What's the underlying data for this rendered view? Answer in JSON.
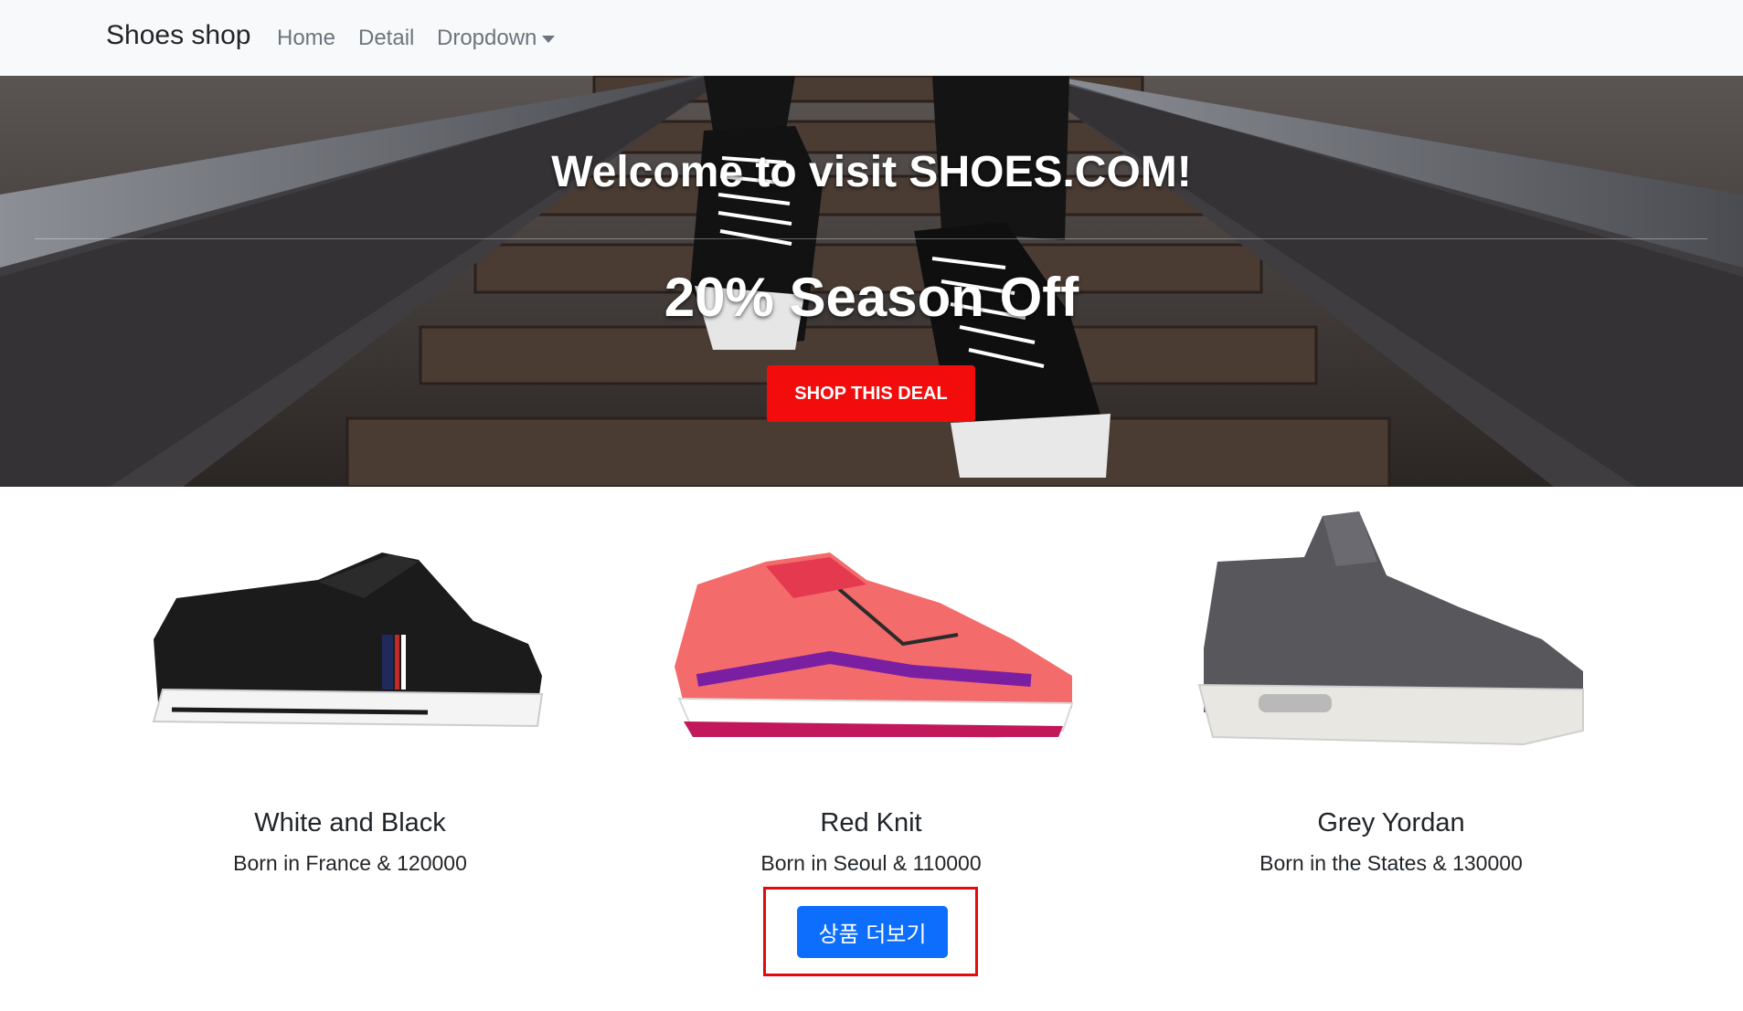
{
  "navbar": {
    "brand": "Shoes shop",
    "links": [
      "Home",
      "Detail"
    ],
    "dropdown_label": "Dropdown"
  },
  "hero": {
    "title": "Welcome to visit SHOES.COM!",
    "subtitle": "20% Season Off",
    "button_label": "SHOP THIS DEAL",
    "button_color": "#f20c0c"
  },
  "products": [
    {
      "name": "White and Black",
      "desc": "Born in France & 120000"
    },
    {
      "name": "Red Knit",
      "desc": "Born in Seoul & 110000"
    },
    {
      "name": "Grey Yordan",
      "desc": "Born in the States & 130000"
    }
  ],
  "more_button": {
    "label": "상품 더보기",
    "color": "#0d6efd",
    "highlight_color": "#e40b0b"
  }
}
